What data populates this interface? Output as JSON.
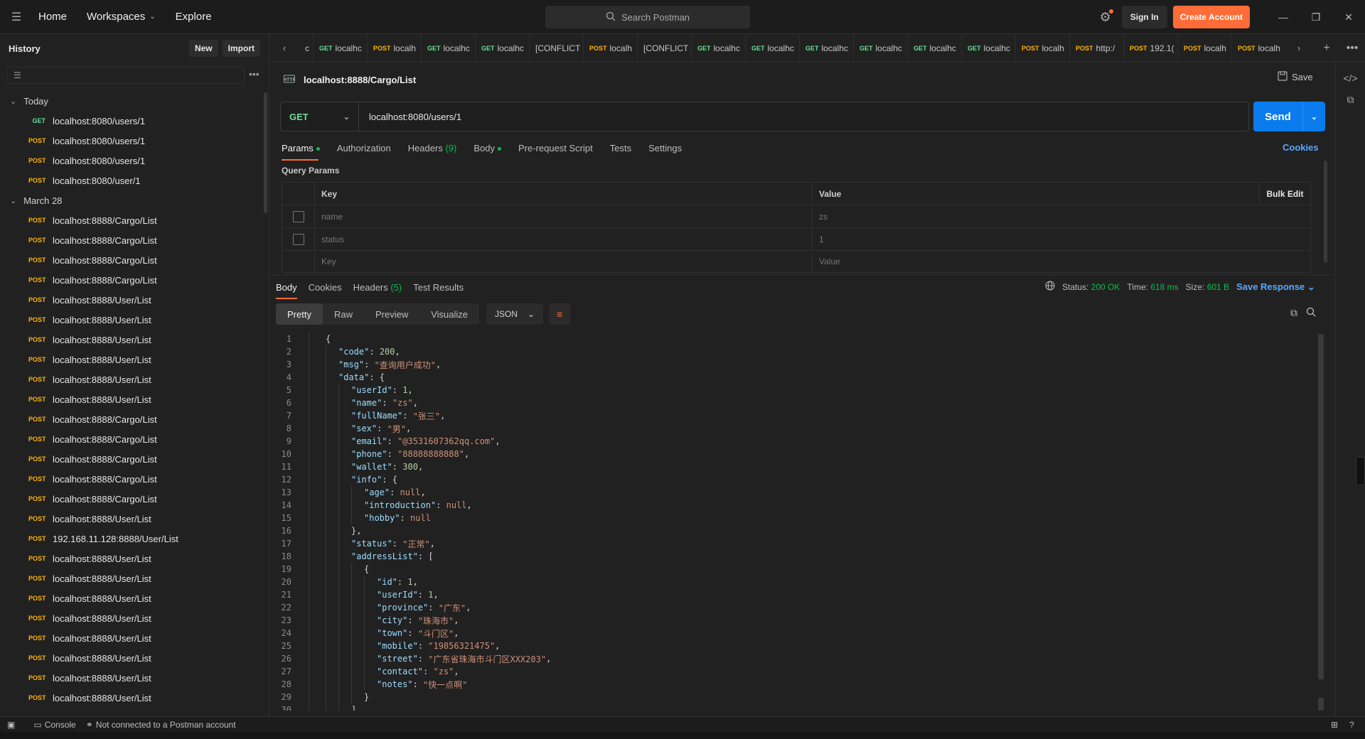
{
  "topbar": {
    "nav": [
      "Home",
      "Workspaces",
      "Explore"
    ],
    "search_placeholder": "Search Postman",
    "sign_in": "Sign In",
    "create_account": "Create Account"
  },
  "sidebar": {
    "title": "History",
    "new_label": "New",
    "import_label": "Import",
    "groups": [
      {
        "label": "Today",
        "items": [
          {
            "method": "GET",
            "url": "localhost:8080/users/1"
          },
          {
            "method": "POST",
            "url": "localhost:8080/users/1"
          },
          {
            "method": "POST",
            "url": "localhost:8080/users/1"
          },
          {
            "method": "POST",
            "url": "localhost:8080/user/1"
          }
        ]
      },
      {
        "label": "March 28",
        "items": [
          {
            "method": "POST",
            "url": "localhost:8888/Cargo/List"
          },
          {
            "method": "POST",
            "url": "localhost:8888/Cargo/List"
          },
          {
            "method": "POST",
            "url": "localhost:8888/Cargo/List"
          },
          {
            "method": "POST",
            "url": "localhost:8888/Cargo/List"
          },
          {
            "method": "POST",
            "url": "localhost:8888/User/List"
          },
          {
            "method": "POST",
            "url": "localhost:8888/User/List"
          },
          {
            "method": "POST",
            "url": "localhost:8888/User/List"
          },
          {
            "method": "POST",
            "url": "localhost:8888/User/List"
          },
          {
            "method": "POST",
            "url": "localhost:8888/User/List"
          },
          {
            "method": "POST",
            "url": "localhost:8888/User/List"
          },
          {
            "method": "POST",
            "url": "localhost:8888/Cargo/List"
          },
          {
            "method": "POST",
            "url": "localhost:8888/Cargo/List"
          },
          {
            "method": "POST",
            "url": "localhost:8888/Cargo/List"
          },
          {
            "method": "POST",
            "url": "localhost:8888/Cargo/List"
          },
          {
            "method": "POST",
            "url": "localhost:8888/Cargo/List"
          },
          {
            "method": "POST",
            "url": "localhost:8888/User/List"
          },
          {
            "method": "POST",
            "url": "192.168.11.128:8888/User/List"
          },
          {
            "method": "POST",
            "url": "localhost:8888/User/List"
          },
          {
            "method": "POST",
            "url": "localhost:8888/User/List"
          },
          {
            "method": "POST",
            "url": "localhost:8888/User/List"
          },
          {
            "method": "POST",
            "url": "localhost:8888/User/List"
          },
          {
            "method": "POST",
            "url": "localhost:8888/User/List"
          },
          {
            "method": "POST",
            "url": "localhost:8888/User/List"
          },
          {
            "method": "POST",
            "url": "localhost:8888/User/List"
          },
          {
            "method": "POST",
            "url": "localhost:8888/User/List"
          }
        ]
      }
    ]
  },
  "tabs": [
    {
      "method": "",
      "label": "c"
    },
    {
      "method": "GET",
      "label": "localhc"
    },
    {
      "method": "POST",
      "label": "localh"
    },
    {
      "method": "GET",
      "label": "localhc"
    },
    {
      "method": "GET",
      "label": "localhc"
    },
    {
      "method": "",
      "label": "[CONFLICT"
    },
    {
      "method": "POST",
      "label": "localh"
    },
    {
      "method": "",
      "label": "[CONFLICT"
    },
    {
      "method": "GET",
      "label": "localhc"
    },
    {
      "method": "GET",
      "label": "localhc"
    },
    {
      "method": "GET",
      "label": "localhc"
    },
    {
      "method": "GET",
      "label": "localhc"
    },
    {
      "method": "GET",
      "label": "localhc"
    },
    {
      "method": "GET",
      "label": "localhc"
    },
    {
      "method": "POST",
      "label": "localh"
    },
    {
      "method": "POST",
      "label": "http:/"
    },
    {
      "method": "POST",
      "label": "192.1("
    },
    {
      "method": "POST",
      "label": "localh"
    },
    {
      "method": "POST",
      "label": "localh"
    }
  ],
  "request": {
    "title": "localhost:8888/Cargo/List",
    "save_label": "Save",
    "method": "GET",
    "url": "localhost:8080/users/1",
    "send_label": "Send",
    "tabs": [
      "Params",
      "Authorization",
      "Headers",
      "Body",
      "Pre-request Script",
      "Tests",
      "Settings"
    ],
    "headers_count": "(9)",
    "cookies_label": "Cookies",
    "query_params_title": "Query Params",
    "columns": {
      "key": "Key",
      "value": "Value",
      "bulk_edit": "Bulk Edit"
    },
    "params": [
      {
        "key": "name",
        "value": "zs"
      },
      {
        "key": "status",
        "value": "1"
      }
    ],
    "placeholder": {
      "key": "Key",
      "value": "Value"
    }
  },
  "response": {
    "tabs": [
      "Body",
      "Cookies",
      "Headers",
      "Test Results"
    ],
    "headers_count": "(5)",
    "status_label": "Status:",
    "status_value": "200 OK",
    "time_label": "Time:",
    "time_value": "618 ms",
    "size_label": "Size:",
    "size_value": "601 B",
    "save_response": "Save Response",
    "views": [
      "Pretty",
      "Raw",
      "Preview",
      "Visualize"
    ],
    "format": "JSON"
  },
  "code_lines": [
    {
      "n": "1",
      "i": 0,
      "t": [
        [
          "p",
          "{"
        ]
      ]
    },
    {
      "n": "2",
      "i": 1,
      "t": [
        [
          "k",
          "\"code\""
        ],
        [
          "p",
          ": "
        ],
        [
          "n",
          "200"
        ],
        [
          "p",
          ","
        ]
      ]
    },
    {
      "n": "3",
      "i": 1,
      "t": [
        [
          "k",
          "\"msg\""
        ],
        [
          "p",
          ": "
        ],
        [
          "s",
          "\"查询用户成功\""
        ],
        [
          "p",
          ","
        ]
      ]
    },
    {
      "n": "4",
      "i": 1,
      "t": [
        [
          "k",
          "\"data\""
        ],
        [
          "p",
          ": {"
        ]
      ]
    },
    {
      "n": "5",
      "i": 2,
      "t": [
        [
          "k",
          "\"userId\""
        ],
        [
          "p",
          ": "
        ],
        [
          "n",
          "1"
        ],
        [
          "p",
          ","
        ]
      ]
    },
    {
      "n": "6",
      "i": 2,
      "t": [
        [
          "k",
          "\"name\""
        ],
        [
          "p",
          ": "
        ],
        [
          "s",
          "\"zs\""
        ],
        [
          "p",
          ","
        ]
      ]
    },
    {
      "n": "7",
      "i": 2,
      "t": [
        [
          "k",
          "\"fullName\""
        ],
        [
          "p",
          ": "
        ],
        [
          "s",
          "\"张三\""
        ],
        [
          "p",
          ","
        ]
      ]
    },
    {
      "n": "8",
      "i": 2,
      "t": [
        [
          "k",
          "\"sex\""
        ],
        [
          "p",
          ": "
        ],
        [
          "s",
          "\"男\""
        ],
        [
          "p",
          ","
        ]
      ]
    },
    {
      "n": "9",
      "i": 2,
      "t": [
        [
          "k",
          "\"email\""
        ],
        [
          "p",
          ": "
        ],
        [
          "s",
          "\"@3531607362qq.com\""
        ],
        [
          "p",
          ","
        ]
      ]
    },
    {
      "n": "10",
      "i": 2,
      "t": [
        [
          "k",
          "\"phone\""
        ],
        [
          "p",
          ": "
        ],
        [
          "s",
          "\"88888888888\""
        ],
        [
          "p",
          ","
        ]
      ]
    },
    {
      "n": "11",
      "i": 2,
      "t": [
        [
          "k",
          "\"wallet\""
        ],
        [
          "p",
          ": "
        ],
        [
          "n",
          "300"
        ],
        [
          "p",
          ","
        ]
      ]
    },
    {
      "n": "12",
      "i": 2,
      "t": [
        [
          "k",
          "\"info\""
        ],
        [
          "p",
          ": {"
        ]
      ]
    },
    {
      "n": "13",
      "i": 3,
      "t": [
        [
          "k",
          "\"age\""
        ],
        [
          "p",
          ": "
        ],
        [
          "s",
          "null"
        ],
        [
          "p",
          ","
        ]
      ]
    },
    {
      "n": "14",
      "i": 3,
      "t": [
        [
          "k",
          "\"introduction\""
        ],
        [
          "p",
          ": "
        ],
        [
          "s",
          "null"
        ],
        [
          "p",
          ","
        ]
      ]
    },
    {
      "n": "15",
      "i": 3,
      "t": [
        [
          "k",
          "\"hobby\""
        ],
        [
          "p",
          ": "
        ],
        [
          "s",
          "null"
        ]
      ]
    },
    {
      "n": "16",
      "i": 2,
      "t": [
        [
          "p",
          "},"
        ]
      ]
    },
    {
      "n": "17",
      "i": 2,
      "t": [
        [
          "k",
          "\"status\""
        ],
        [
          "p",
          ": "
        ],
        [
          "s",
          "\"正常\""
        ],
        [
          "p",
          ","
        ]
      ]
    },
    {
      "n": "18",
      "i": 2,
      "t": [
        [
          "k",
          "\"addressList\""
        ],
        [
          "p",
          ": ["
        ]
      ]
    },
    {
      "n": "19",
      "i": 3,
      "t": [
        [
          "p",
          "{"
        ]
      ]
    },
    {
      "n": "20",
      "i": 4,
      "t": [
        [
          "k",
          "\"id\""
        ],
        [
          "p",
          ": "
        ],
        [
          "n",
          "1"
        ],
        [
          "p",
          ","
        ]
      ]
    },
    {
      "n": "21",
      "i": 4,
      "t": [
        [
          "k",
          "\"userId\""
        ],
        [
          "p",
          ": "
        ],
        [
          "n",
          "1"
        ],
        [
          "p",
          ","
        ]
      ]
    },
    {
      "n": "22",
      "i": 4,
      "t": [
        [
          "k",
          "\"province\""
        ],
        [
          "p",
          ": "
        ],
        [
          "s",
          "\"广东\""
        ],
        [
          "p",
          ","
        ]
      ]
    },
    {
      "n": "23",
      "i": 4,
      "t": [
        [
          "k",
          "\"city\""
        ],
        [
          "p",
          ": "
        ],
        [
          "s",
          "\"珠海市\""
        ],
        [
          "p",
          ","
        ]
      ]
    },
    {
      "n": "24",
      "i": 4,
      "t": [
        [
          "k",
          "\"town\""
        ],
        [
          "p",
          ": "
        ],
        [
          "s",
          "\"斗门区\""
        ],
        [
          "p",
          ","
        ]
      ]
    },
    {
      "n": "25",
      "i": 4,
      "t": [
        [
          "k",
          "\"mobile\""
        ],
        [
          "p",
          ": "
        ],
        [
          "s",
          "\"19856321475\""
        ],
        [
          "p",
          ","
        ]
      ]
    },
    {
      "n": "26",
      "i": 4,
      "t": [
        [
          "k",
          "\"street\""
        ],
        [
          "p",
          ": "
        ],
        [
          "s",
          "\"广东省珠海市斗门区XXX203\""
        ],
        [
          "p",
          ","
        ]
      ]
    },
    {
      "n": "27",
      "i": 4,
      "t": [
        [
          "k",
          "\"contact\""
        ],
        [
          "p",
          ": "
        ],
        [
          "s",
          "\"zs\""
        ],
        [
          "p",
          ","
        ]
      ]
    },
    {
      "n": "28",
      "i": 4,
      "t": [
        [
          "k",
          "\"notes\""
        ],
        [
          "p",
          ": "
        ],
        [
          "s",
          "\"快一点啊\""
        ]
      ]
    },
    {
      "n": "29",
      "i": 3,
      "t": [
        [
          "p",
          "}"
        ]
      ]
    },
    {
      "n": "30",
      "i": 2,
      "t": [
        [
          "p",
          "]"
        ]
      ]
    }
  ],
  "statusbar": {
    "console": "Console",
    "account": "Not connected to a Postman account"
  },
  "colors": {
    "accent": "#ff6c37",
    "send": "#097bed",
    "get": "#6bdd9a",
    "post": "#ffb400",
    "ok": "#0cbb52"
  }
}
